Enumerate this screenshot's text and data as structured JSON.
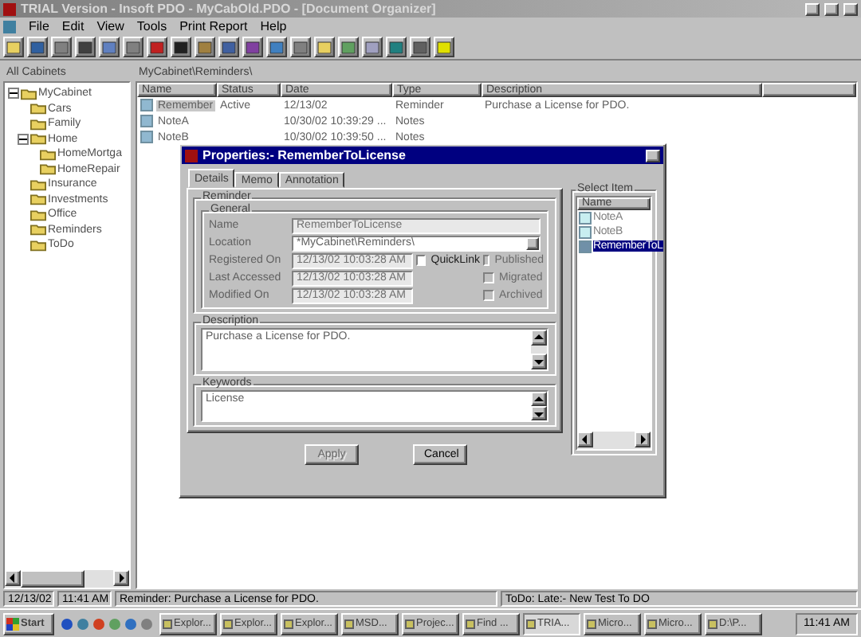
{
  "window": {
    "title": "TRIAL Version - Insoft PDO - MyCabOld.PDO - [Document Organizer]"
  },
  "menu": [
    "File",
    "Edit",
    "View",
    "Tools",
    "Print Report",
    "Help"
  ],
  "left_pane": {
    "title": "All Cabinets",
    "tree": [
      {
        "label": "MyCabinet",
        "expanded": true,
        "children": [
          {
            "label": "Cars"
          },
          {
            "label": "Family"
          },
          {
            "label": "Home",
            "expanded": true,
            "children": [
              {
                "label": "HomeMortga"
              },
              {
                "label": "HomeRepair"
              }
            ]
          },
          {
            "label": "Insurance"
          },
          {
            "label": "Investments"
          },
          {
            "label": "Office"
          },
          {
            "label": "Reminders"
          },
          {
            "label": "ToDo"
          }
        ]
      }
    ]
  },
  "list": {
    "path": "MyCabinet\\Reminders\\",
    "columns": [
      "Name",
      "Status",
      "Date",
      "Type",
      "Description"
    ],
    "rows": [
      {
        "cells": [
          "Remember",
          "Active",
          "12/13/02",
          "Reminder",
          "Purchase a License for PDO."
        ],
        "selected": true
      },
      {
        "cells": [
          "NoteA",
          "",
          "10/30/02 10:39:29 ...",
          "Notes",
          ""
        ],
        "selected": false
      },
      {
        "cells": [
          "NoteB",
          "",
          "10/30/02 10:39:50 ...",
          "Notes",
          ""
        ],
        "selected": false
      }
    ]
  },
  "dialog": {
    "title": "Properties:- RememberToLicense",
    "tabs": [
      {
        "label": "Details",
        "selected": true
      },
      {
        "label": "Memo",
        "selected": false
      },
      {
        "label": "Annotation",
        "selected": false
      }
    ],
    "group": "Reminder",
    "subgroup": "General",
    "fields": [
      {
        "label": "Name",
        "value": "RememberToLicense",
        "kind": "text"
      },
      {
        "label": "Location",
        "value": "*MyCabinet\\Reminders\\",
        "kind": "dropdown"
      },
      {
        "label": "Registered On",
        "value": "12/13/02 10:03:28 AM",
        "kind": "date"
      },
      {
        "label": "Last Accessed",
        "value": "12/13/02 10:03:28 AM",
        "kind": "date"
      },
      {
        "label": "Modified On",
        "value": "12/13/02 10:03:28 AM",
        "kind": "date"
      }
    ],
    "quicklink": {
      "label": "QuickLink",
      "checked": false,
      "disabled": false
    },
    "flags": [
      {
        "label": "Published",
        "checked": false,
        "disabled": true
      },
      {
        "label": "Migrated",
        "checked": false,
        "disabled": true
      },
      {
        "label": "Archived",
        "checked": false,
        "disabled": true
      }
    ],
    "description": {
      "title": "Description",
      "value": "Purchase a License for PDO."
    },
    "keywords": {
      "title": "Keywords",
      "value": "License"
    },
    "select_item": {
      "title": "Select Item",
      "column": "Name",
      "items": [
        {
          "label": "NoteA",
          "selected": false
        },
        {
          "label": "NoteB",
          "selected": false
        },
        {
          "label": "RememberToL",
          "selected": true
        }
      ]
    },
    "buttons": [
      {
        "label": "Apply",
        "disabled": true
      },
      {
        "label": "Cancel",
        "disabled": false
      }
    ]
  },
  "status_bar": [
    "12/13/02",
    "11:41 AM",
    "Reminder: Purchase a License for PDO.",
    "ToDo: Late:- New Test To DO"
  ],
  "taskbar": {
    "start": "Start",
    "tasks": [
      {
        "label": "Explor...",
        "selected": false
      },
      {
        "label": "Explor...",
        "selected": false
      },
      {
        "label": "Explor...",
        "selected": false
      },
      {
        "label": "MSD...",
        "selected": false
      },
      {
        "label": "Projec...",
        "selected": false
      },
      {
        "label": "Find ...",
        "selected": false
      },
      {
        "label": "TRIA...",
        "selected": true
      },
      {
        "label": "Micro...",
        "selected": false
      },
      {
        "label": "Micro...",
        "selected": false
      },
      {
        "label": "D:\\P...",
        "selected": false
      }
    ],
    "clock": "11:41 AM"
  }
}
